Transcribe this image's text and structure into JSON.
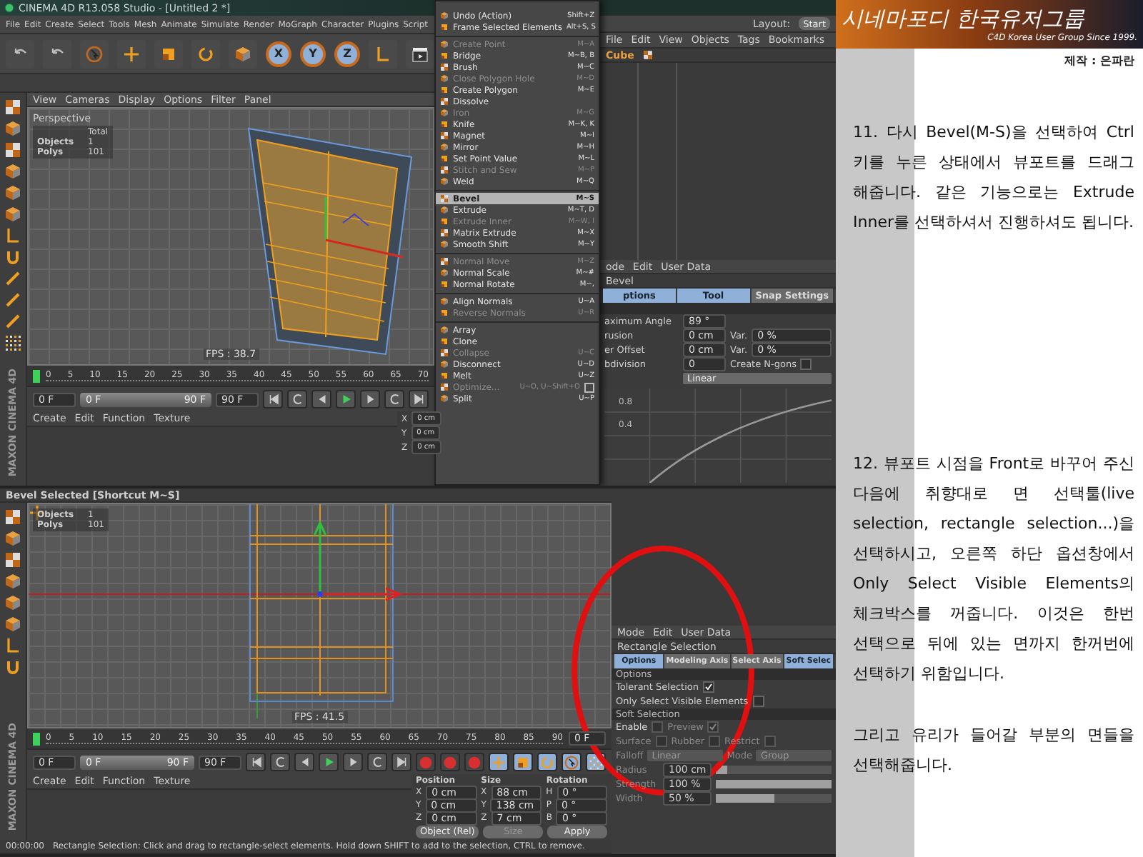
{
  "top_window": {
    "title": "CINEMA 4D R13.058 Studio - [Untitled 2 *]",
    "menu_bar": [
      "File",
      "Edit",
      "Create",
      "Select",
      "Tools",
      "Mesh",
      "Animate",
      "Simulate",
      "Render",
      "MoGraph",
      "Character",
      "Plugins",
      "Script"
    ],
    "axis_locks": [
      "X",
      "Y",
      "Z"
    ],
    "viewport": {
      "menu": [
        "View",
        "Cameras",
        "Display",
        "Options",
        "Filter",
        "Panel"
      ],
      "camera": "Perspective",
      "stats_header": "Total",
      "stats": [
        {
          "label": "Objects",
          "value": "1"
        },
        {
          "label": "Polys",
          "value": "101"
        }
      ],
      "fps": "FPS : 38.7"
    },
    "logo": "MAXON CINEMA 4D",
    "timeline": [
      "0",
      "5",
      "10",
      "15",
      "20",
      "25",
      "30",
      "35",
      "40",
      "45",
      "50",
      "55",
      "60",
      "65",
      "70"
    ],
    "transport": {
      "current": "0 F",
      "range_start": "0 F",
      "range_end": "90 F",
      "end": "90 F",
      "level": 1
    },
    "material_menu": [
      "Create",
      "Edit",
      "Function",
      "Texture"
    ],
    "coordinates": [
      {
        "axis": "X",
        "value": "0 cm"
      },
      {
        "axis": "Y",
        "value": "0 cm"
      },
      {
        "axis": "Z",
        "value": "0 cm"
      }
    ],
    "mesh_menu": [
      {
        "kind": "item",
        "label": "Undo (Action)",
        "shortcut": "Shift+Z",
        "selected": false,
        "disabled": false
      },
      {
        "kind": "item",
        "label": "Frame Selected Elements",
        "shortcut": "Alt+S, S",
        "selected": false,
        "disabled": false
      },
      {
        "kind": "separator"
      },
      {
        "kind": "item",
        "label": "Create Point",
        "shortcut": "M~A",
        "selected": false,
        "disabled": true
      },
      {
        "kind": "item",
        "label": "Bridge",
        "shortcut": "M~B, B",
        "selected": false,
        "disabled": false
      },
      {
        "kind": "item",
        "label": "Brush",
        "shortcut": "M~C",
        "selected": false,
        "disabled": false
      },
      {
        "kind": "item",
        "label": "Close Polygon Hole",
        "shortcut": "M~D",
        "selected": false,
        "disabled": true
      },
      {
        "kind": "item",
        "label": "Create Polygon",
        "shortcut": "M~E",
        "selected": false,
        "disabled": false
      },
      {
        "kind": "item",
        "label": "Dissolve",
        "selected": false,
        "disabled": false
      },
      {
        "kind": "item",
        "label": "Iron",
        "shortcut": "M~G",
        "selected": false,
        "disabled": true
      },
      {
        "kind": "item",
        "label": "Knife",
        "shortcut": "M~K, K",
        "selected": false,
        "disabled": false
      },
      {
        "kind": "item",
        "label": "Magnet",
        "shortcut": "M~I",
        "selected": false,
        "disabled": false
      },
      {
        "kind": "item",
        "label": "Mirror",
        "shortcut": "M~H",
        "selected": false,
        "disabled": false
      },
      {
        "kind": "item",
        "label": "Set Point Value",
        "shortcut": "M~L",
        "selected": false,
        "disabled": false
      },
      {
        "kind": "item",
        "label": "Stitch and Sew",
        "shortcut": "M~P",
        "selected": false,
        "disabled": true
      },
      {
        "kind": "item",
        "label": "Weld",
        "shortcut": "M~Q",
        "selected": false,
        "disabled": false
      },
      {
        "kind": "separator"
      },
      {
        "kind": "item",
        "label": "Bevel",
        "shortcut": "M~S",
        "selected": true,
        "disabled": false
      },
      {
        "kind": "item",
        "label": "Extrude",
        "shortcut": "M~T, D",
        "selected": false,
        "disabled": false
      },
      {
        "kind": "item",
        "label": "Extrude Inner",
        "shortcut": "M~W, I",
        "selected": false,
        "disabled": true
      },
      {
        "kind": "item",
        "label": "Matrix Extrude",
        "shortcut": "M~X",
        "selected": false,
        "disabled": false
      },
      {
        "kind": "item",
        "label": "Smooth Shift",
        "shortcut": "M~Y",
        "selected": false,
        "disabled": false
      },
      {
        "kind": "separator"
      },
      {
        "kind": "item",
        "label": "Normal Move",
        "shortcut": "M~Z",
        "selected": false,
        "disabled": true
      },
      {
        "kind": "item",
        "label": "Normal Scale",
        "shortcut": "M~#",
        "selected": false,
        "disabled": false
      },
      {
        "kind": "item",
        "label": "Normal Rotate",
        "shortcut": "M~,",
        "selected": false,
        "disabled": false
      },
      {
        "kind": "separator"
      },
      {
        "kind": "item",
        "label": "Align Normals",
        "shortcut": "U~A",
        "selected": false,
        "disabled": false
      },
      {
        "kind": "item",
        "label": "Reverse Normals",
        "shortcut": "U~R",
        "selected": false,
        "disabled": true
      },
      {
        "kind": "separator"
      },
      {
        "kind": "item",
        "label": "Array",
        "selected": false,
        "disabled": false
      },
      {
        "kind": "item",
        "label": "Clone",
        "selected": false,
        "disabled": false
      },
      {
        "kind": "item",
        "label": "Collapse",
        "shortcut": "U~C",
        "selected": false,
        "disabled": true
      },
      {
        "kind": "item",
        "label": "Disconnect",
        "shortcut": "U~D",
        "selected": false,
        "disabled": false
      },
      {
        "kind": "item",
        "label": "Melt",
        "shortcut": "U~Z",
        "selected": false,
        "disabled": false
      },
      {
        "kind": "item",
        "label": "Optimize...",
        "shortcut": "U~O, U~Shift+O",
        "selected": false,
        "disabled": true,
        "options": true
      },
      {
        "kind": "item",
        "label": "Split",
        "shortcut": "U~P",
        "selected": false,
        "disabled": false
      }
    ],
    "layout": {
      "label": "Layout:",
      "value": "Start"
    },
    "object_manager": {
      "menu": [
        "File",
        "Edit",
        "View",
        "Objects",
        "Tags",
        "Bookmarks"
      ],
      "object": "Cube"
    },
    "attributes": {
      "menu": [
        "ode",
        "Edit",
        "User Data"
      ],
      "title": "Bevel",
      "tabs": [
        {
          "label": "ptions",
          "selected": true
        },
        {
          "label": "Tool",
          "selected": true
        },
        {
          "label": "Snap Settings",
          "selected": false
        }
      ],
      "fields": [
        {
          "kind": "plain",
          "label": "aximum Angle",
          "value": "89 °"
        },
        {
          "kind": "variation",
          "label": "rusion",
          "value": "0 cm",
          "var_label": "Var.",
          "var_value": "0 %"
        },
        {
          "kind": "variation",
          "label": "er Offset",
          "value": "0 cm",
          "var_label": "Var.",
          "var_value": "0 %"
        },
        {
          "kind": "checkbox",
          "label": "bdivision",
          "value": "0",
          "check_label": "Create N-gons",
          "checked": false
        }
      ],
      "shape": "Linear",
      "graph_labels": [
        "0.8",
        "0.4"
      ]
    }
  },
  "bottom_window": {
    "viewport_title": "Bevel Selected [Shortcut M~S]",
    "stats": [
      {
        "label": "Objects",
        "value": "1"
      },
      {
        "label": "Polys",
        "value": "101"
      }
    ],
    "fps": "FPS : 41.5",
    "timeline": [
      "0",
      "5",
      "10",
      "15",
      "20",
      "25",
      "30",
      "35",
      "40",
      "45",
      "50",
      "55",
      "60",
      "65",
      "70",
      "75",
      "80",
      "85",
      "90"
    ],
    "logo": "MAXON CINEMA 4D",
    "frame": "0 F",
    "transport": {
      "current": "0 F",
      "range_start": "0 F",
      "range_end": "90 F",
      "end": "90 F",
      "level": 1
    },
    "material_menu": [
      "Create",
      "Edit",
      "Function",
      "Texture"
    ],
    "coordinates": {
      "headers": [
        "Position",
        "Size",
        "Rotation"
      ],
      "rows": [
        {
          "cells": [
            {
              "axis": "X",
              "value": "0 cm"
            },
            {
              "axis": "X",
              "value": "88 cm"
            },
            {
              "axis": "H",
              "value": "0 °"
            }
          ]
        },
        {
          "cells": [
            {
              "axis": "Y",
              "value": "0 cm"
            },
            {
              "axis": "Y",
              "value": "138 cm"
            },
            {
              "axis": "P",
              "value": "0 °"
            }
          ]
        },
        {
          "cells": [
            {
              "axis": "Z",
              "value": "0 cm"
            },
            {
              "axis": "Z",
              "value": "7 cm"
            },
            {
              "axis": "B",
              "value": "0 °"
            }
          ]
        }
      ],
      "mode": "Object (Rel)",
      "size_mode": "Size",
      "apply": "Apply"
    },
    "status_time": "00:00:00",
    "status_text": "Rectangle Selection: Click and drag to rectangle-select elements. Hold down SHIFT to add to the selection, CTRL to remove.",
    "attributes": {
      "menu": [
        "Mode",
        "Edit",
        "User Data"
      ],
      "title": "Rectangle Selection",
      "tabs": [
        {
          "label": "Options",
          "selected": true
        },
        {
          "label": "Modeling Axis",
          "selected": false
        },
        {
          "label": "Select Axis",
          "selected": false
        },
        {
          "label": "Soft Selec",
          "selected": true
        }
      ],
      "options": {
        "title": "Options",
        "checks": [
          {
            "label": "Tolerant Selection",
            "checked": true
          },
          {
            "label": "Only Select Visible Elements",
            "checked": false
          }
        ]
      },
      "soft_selection": {
        "title": "Soft Selection",
        "check_rows": [
          {
            "items": [
              {
                "label": "Enable",
                "checked": false
              },
              {
                "label": "Preview",
                "checked": true
              }
            ]
          },
          {
            "items": [
              {
                "label": "Surface",
                "checked": false
              },
              {
                "label": "Rubber",
                "checked": false
              },
              {
                "label": "Restrict",
                "checked": false
              }
            ]
          }
        ],
        "dropdowns": [
          {
            "label": "Falloff",
            "value": "Linear"
          },
          {
            "label": "Mode",
            "value": "Group"
          }
        ],
        "sliders": [
          {
            "label": "Radius",
            "value": "100 cm",
            "level": 0.1
          },
          {
            "label": "Strength",
            "value": "100 %",
            "level": 1
          },
          {
            "label": "Width",
            "value": "50 %",
            "level": 0.5
          }
        ]
      }
    }
  },
  "article": {
    "banner_title": "시네마포디 한국유저그룹",
    "banner_subtitle": "C4D Korea User Group Since 1999.",
    "credit": "제작 : 은파란",
    "paragraphs": [
      "11. 다시 Bevel(M-S)을 선택하여 Ctrl 키를 누른 상태에서 뷰포트를 드래그 해줍니다. 같은 기능으로는 Extrude Inner를 선택하셔서 진행하셔도 됩니다.",
      "12. 뷰포트 시점을 Front로 바꾸어 주신 다음에 취향대로 면 선택툴(live selection, rectangle selection...)을 선택하시고, 오른쪽 하단 옵션창에서 Only Select Visible Elements의 체크박스를 꺼줍니다. 이것은 한번 선택으로 뒤에 있는 면까지 한꺼번에 선택하기 위함입니다.",
      "그리고 유리가 들어갈 부분의 면들을 선택해줍니다."
    ]
  }
}
